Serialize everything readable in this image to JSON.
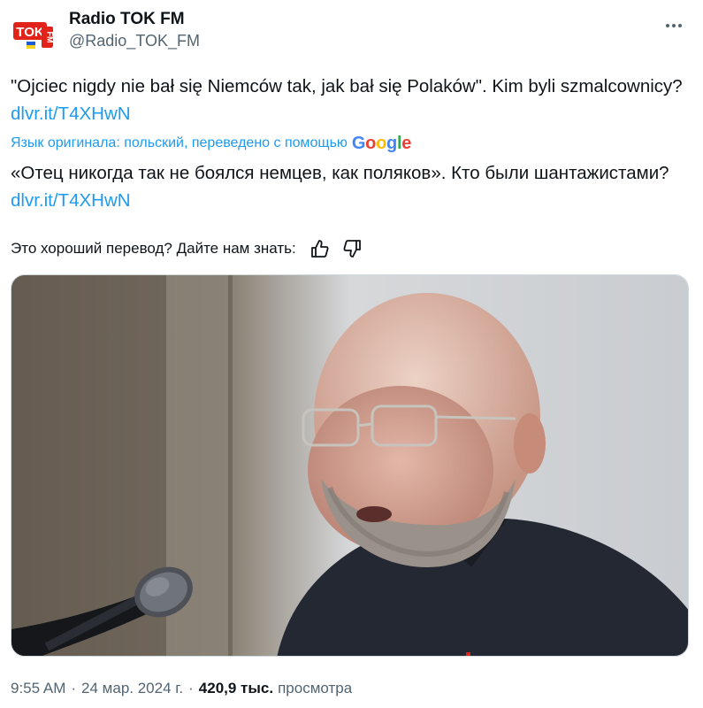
{
  "author": {
    "display_name": "Radio TOK FM",
    "handle": "@Radio_TOK_FM",
    "avatar_text_top": "TOK",
    "avatar_text_side": "FM"
  },
  "tweet": {
    "text": "\"Ojciec nigdy nie bał się Niemców tak, jak bał się Polaków\". Kim byli szmalcownicy?",
    "link": "dlvr.it/T4XHwN"
  },
  "translation": {
    "note": "Язык оригинала: польский, переведено с помощью",
    "provider": "Google",
    "text": "«Отец никогда так не боялся немцев, как поляков». Кто были шантажистами?",
    "link": "dlvr.it/T4XHwN",
    "feedback_prompt": "Это хороший перевод? Дайте нам знать:"
  },
  "meta": {
    "time": "9:55 AM",
    "date": "24 мар. 2024 г.",
    "views_count": "420,9 тыс.",
    "views_label": "просмотра"
  },
  "colors": {
    "accent": "#1d9bf0",
    "secondary_text": "#536471",
    "brand_red": "#e2231a"
  }
}
